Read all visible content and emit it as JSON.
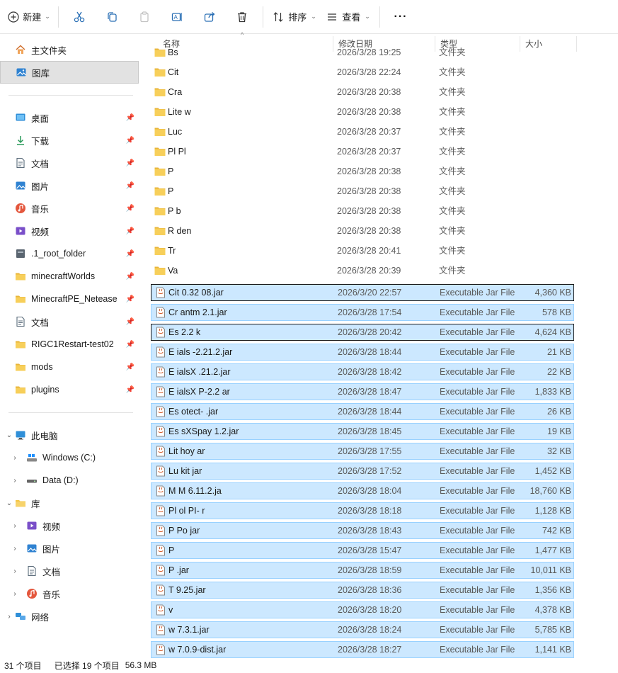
{
  "toolbar": {
    "new_label": "新建",
    "sort_label": "排序",
    "view_label": "查看",
    "more_label": "···"
  },
  "nav": {
    "home": "主文件夹",
    "gallery": "图库",
    "quick": [
      {
        "label": "桌面",
        "icon": "desktop-icon"
      },
      {
        "label": "下载",
        "icon": "download-icon"
      },
      {
        "label": "文档",
        "icon": "document-icon"
      },
      {
        "label": "图片",
        "icon": "picture-icon"
      },
      {
        "label": "音乐",
        "icon": "music-icon"
      },
      {
        "label": "视频",
        "icon": "video-icon"
      },
      {
        "label": ".1_root_folder",
        "icon": "drive-folder-icon"
      },
      {
        "label": "minecraftWorlds",
        "icon": "folder-icon"
      },
      {
        "label": "MinecraftPE_Netease",
        "icon": "folder-icon"
      },
      {
        "label": "文档",
        "icon": "document-icon"
      },
      {
        "label": "RIGC1Restart-test02",
        "icon": "folder-icon"
      },
      {
        "label": "mods",
        "icon": "folder-icon"
      },
      {
        "label": "plugins",
        "icon": "folder-icon"
      }
    ],
    "this_pc": "此电脑",
    "drive_c": "Windows (C:)",
    "drive_d": "Data (D:)",
    "library": "库",
    "library_items": [
      "视频",
      "图片",
      "文档",
      "音乐"
    ],
    "network": "网络"
  },
  "columns": {
    "name": "名称",
    "date": "修改日期",
    "type": "类型",
    "size": "大小"
  },
  "rows": [
    {
      "name": "Bs",
      "date": "2026/3/28 19:25",
      "type": "文件夹",
      "size": "",
      "kind": "folder"
    },
    {
      "name": "Cit",
      "date": "2026/3/28 22:24",
      "type": "文件夹",
      "size": "",
      "kind": "folder"
    },
    {
      "name": "Cra",
      "date": "2026/3/28 20:38",
      "type": "文件夹",
      "size": "",
      "kind": "folder"
    },
    {
      "name": "Lite            w",
      "date": "2026/3/28 20:38",
      "type": "文件夹",
      "size": "",
      "kind": "folder"
    },
    {
      "name": "Luc",
      "date": "2026/3/28 20:37",
      "type": "文件夹",
      "size": "",
      "kind": "folder"
    },
    {
      "name": "Pl           Pl",
      "date": "2026/3/28 20:37",
      "type": "文件夹",
      "size": "",
      "kind": "folder"
    },
    {
      "name": "P",
      "date": "2026/3/28 20:38",
      "type": "文件夹",
      "size": "",
      "kind": "folder"
    },
    {
      "name": "P",
      "date": "2026/3/28 20:38",
      "type": "文件夹",
      "size": "",
      "kind": "folder"
    },
    {
      "name": "P           b",
      "date": "2026/3/28 20:38",
      "type": "文件夹",
      "size": "",
      "kind": "folder"
    },
    {
      "name": "R        den",
      "date": "2026/3/28 20:38",
      "type": "文件夹",
      "size": "",
      "kind": "folder"
    },
    {
      "name": "Tr",
      "date": "2026/3/28 20:41",
      "type": "文件夹",
      "size": "",
      "kind": "folder"
    },
    {
      "name": "Va",
      "date": "2026/3/28 20:39",
      "type": "文件夹",
      "size": "",
      "kind": "folder"
    },
    {
      "name": "Cit         0.32     08.jar",
      "date": "2026/3/20 22:57",
      "type": "Executable Jar File",
      "size": "4,360 KB",
      "kind": "jar"
    },
    {
      "name": "Cr        antm     2.1.jar",
      "date": "2026/3/28 17:54",
      "type": "Executable Jar File",
      "size": "578 KB",
      "kind": "jar"
    },
    {
      "name": "Es           2.2   k",
      "date": "2026/3/28 20:42",
      "type": "Executable Jar File",
      "size": "4,624 KB",
      "kind": "jar"
    },
    {
      "name": "E      ials        -2.21.2.jar",
      "date": "2026/3/28 18:44",
      "type": "Executable Jar File",
      "size": "21 KB",
      "kind": "jar"
    },
    {
      "name": "E      ialsX       .21.2.jar",
      "date": "2026/3/28 18:42",
      "type": "Executable Jar File",
      "size": "22 KB",
      "kind": "jar"
    },
    {
      "name": "E      ialsX      P-2.2     ar",
      "date": "2026/3/28 18:47",
      "type": "Executable Jar File",
      "size": "1,833 KB",
      "kind": "jar"
    },
    {
      "name": "Es          otect-     .jar",
      "date": "2026/3/28 18:44",
      "type": "Executable Jar File",
      "size": "26 KB",
      "kind": "jar"
    },
    {
      "name": "Es      sXSpay      1.2.jar",
      "date": "2026/3/28 18:45",
      "type": "Executable Jar File",
      "size": "19 KB",
      "kind": "jar"
    },
    {
      "name": "Lit          hoy      ar",
      "date": "2026/3/28 17:55",
      "type": "Executable Jar File",
      "size": "32 KB",
      "kind": "jar"
    },
    {
      "name": "Lu          kit      jar",
      "date": "2026/3/28 17:52",
      "type": "Executable Jar File",
      "size": "1,452 KB",
      "kind": "jar"
    },
    {
      "name": "M          M      6.11.2.ja",
      "date": "2026/3/28 18:04",
      "type": "Executable Jar File",
      "size": "18,760 KB",
      "kind": "jar"
    },
    {
      "name": "Pl        ol      PI-      r",
      "date": "2026/3/28 18:18",
      "type": "Executable Jar File",
      "size": "1,128 KB",
      "kind": "jar"
    },
    {
      "name": "P          Po         jar",
      "date": "2026/3/28 18:43",
      "type": "Executable Jar File",
      "size": "742 KB",
      "kind": "jar"
    },
    {
      "name": "P",
      "date": "2026/3/28 15:47",
      "type": "Executable Jar File",
      "size": "1,477 KB",
      "kind": "jar"
    },
    {
      "name": "P              .jar",
      "date": "2026/3/28 18:59",
      "type": "Executable Jar File",
      "size": "10,011 KB",
      "kind": "jar"
    },
    {
      "name": "T              9.25.jar",
      "date": "2026/3/28 18:36",
      "type": "Executable Jar File",
      "size": "1,356 KB",
      "kind": "jar"
    },
    {
      "name": "v",
      "date": "2026/3/28 18:20",
      "type": "Executable Jar File",
      "size": "4,378 KB",
      "kind": "jar"
    },
    {
      "name": "w             7.3.1.jar",
      "date": "2026/3/28 18:24",
      "type": "Executable Jar File",
      "size": "5,785 KB",
      "kind": "jar"
    },
    {
      "name": "w              7.0.9-dist.jar",
      "date": "2026/3/28 18:27",
      "type": "Executable Jar File",
      "size": "1,141 KB",
      "kind": "jar"
    }
  ],
  "status": {
    "count": "31 个项目",
    "selected": "已选择 19 个项目",
    "size": "56.3 MB"
  },
  "colors": {
    "selection_bg": "#cce8ff",
    "selection_border": "#99d1ff",
    "folder": "#f4c542",
    "accent": "#0067c0"
  }
}
